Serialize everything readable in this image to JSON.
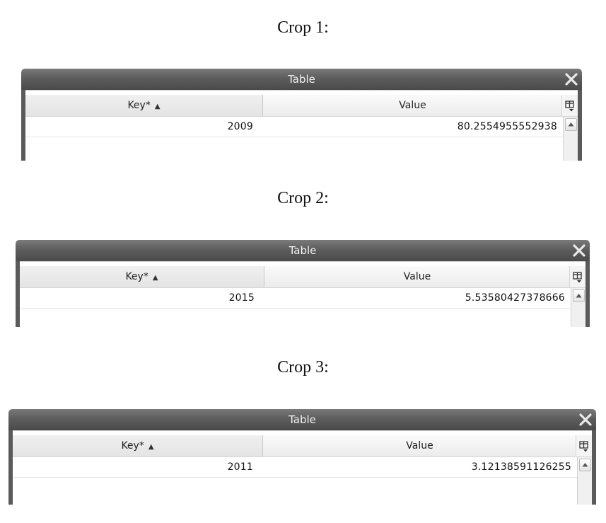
{
  "crops": [
    {
      "caption": "Crop 1:",
      "window_title": "Table",
      "columns": {
        "key": "Key*",
        "value": "Value"
      },
      "sort_indicator": "▲",
      "rows": [
        {
          "key": "2009",
          "value": "80.2554955552938"
        }
      ]
    },
    {
      "caption": "Crop 2:",
      "window_title": "Table",
      "columns": {
        "key": "Key*",
        "value": "Value"
      },
      "sort_indicator": "▲",
      "rows": [
        {
          "key": "2015",
          "value": "5.53580427378666"
        }
      ]
    },
    {
      "caption": "Crop 3:",
      "window_title": "Table",
      "columns": {
        "key": "Key*",
        "value": "Value"
      },
      "sort_indicator": "▲",
      "rows": [
        {
          "key": "2011",
          "value": "3.12138591126255"
        }
      ]
    }
  ],
  "colors": {
    "titlebar": "#5d5d5d",
    "frame": "#5a5a5a",
    "header": "#ececec"
  },
  "icons": {
    "close": "close-icon",
    "column_menu": "column-chooser-icon",
    "scroll_up": "scroll-up-arrow-icon",
    "sort": "sort-ascending-icon"
  }
}
